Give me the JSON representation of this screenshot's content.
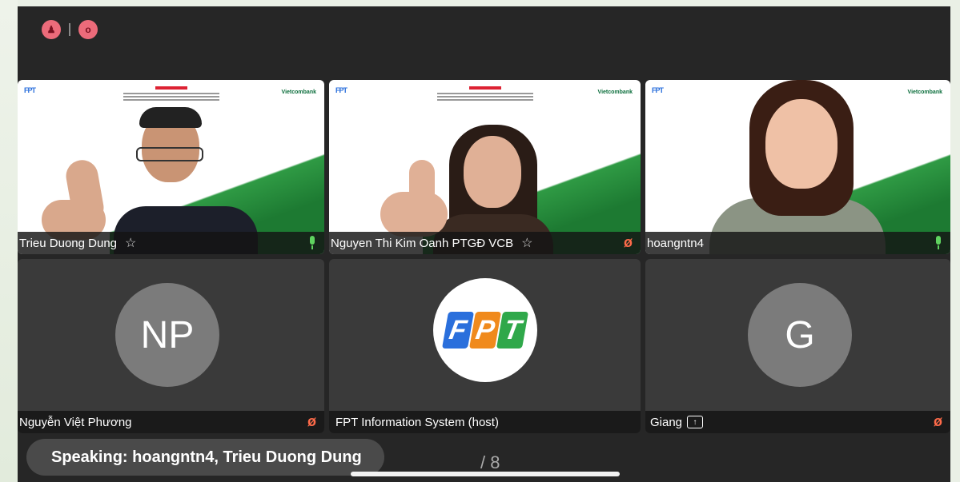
{
  "top_icons": [
    {
      "name": "participant-badge-icon",
      "glyph": "①"
    },
    {
      "name": "record-badge-icon",
      "glyph": "o"
    }
  ],
  "tiles": [
    {
      "name": "Trieu Duong Dung",
      "pinned": true,
      "mic": "on",
      "type": "video"
    },
    {
      "name": "Nguyen Thi Kim Oanh PTGĐ VCB",
      "pinned": true,
      "mic": "off",
      "type": "video"
    },
    {
      "name": "hoangntn4",
      "pinned": false,
      "mic": "on",
      "type": "video"
    },
    {
      "name": "Nguyễn Việt Phương",
      "mic": "off",
      "type": "avatar",
      "initials": "NP"
    },
    {
      "name": "FPT Information System (host)",
      "type": "logo",
      "logo_letters": [
        "F",
        "P",
        "T"
      ]
    },
    {
      "name": "Giang",
      "mic": "off",
      "type": "avatar",
      "initials": "G",
      "sharing": true
    }
  ],
  "slide": {
    "left_logo": "FPT",
    "right_logo": "Vietcombank"
  },
  "speaking_text": "Speaking: hoangntn4, Trieu Duong Dung",
  "page_indicator": "/ 8",
  "colors": {
    "mic_on": "#5fd35f",
    "mic_off": "#ff6b4a",
    "fpt_blue": "#2a6fdc",
    "fpt_orange": "#f08a1c",
    "fpt_green": "#2fa84a"
  }
}
